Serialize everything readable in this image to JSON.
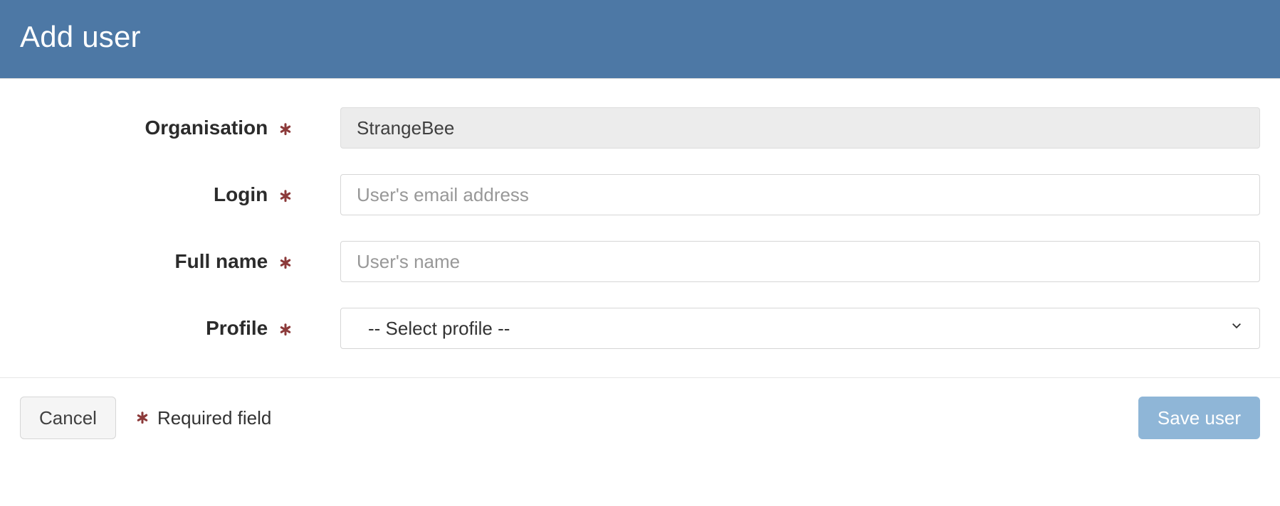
{
  "header": {
    "title": "Add user"
  },
  "form": {
    "organisation": {
      "label": "Organisation",
      "value": "StrangeBee"
    },
    "login": {
      "label": "Login",
      "placeholder": "User's email address",
      "value": ""
    },
    "full_name": {
      "label": "Full name",
      "placeholder": "User's name",
      "value": ""
    },
    "profile": {
      "label": "Profile",
      "placeholder": "-- Select profile --",
      "value": ""
    }
  },
  "footer": {
    "cancel": "Cancel",
    "legend": "Required field",
    "save": "Save user"
  },
  "colors": {
    "header_bg": "#4d78a5",
    "required": "#8c3a3a",
    "save_bg": "#8fb6d7"
  }
}
